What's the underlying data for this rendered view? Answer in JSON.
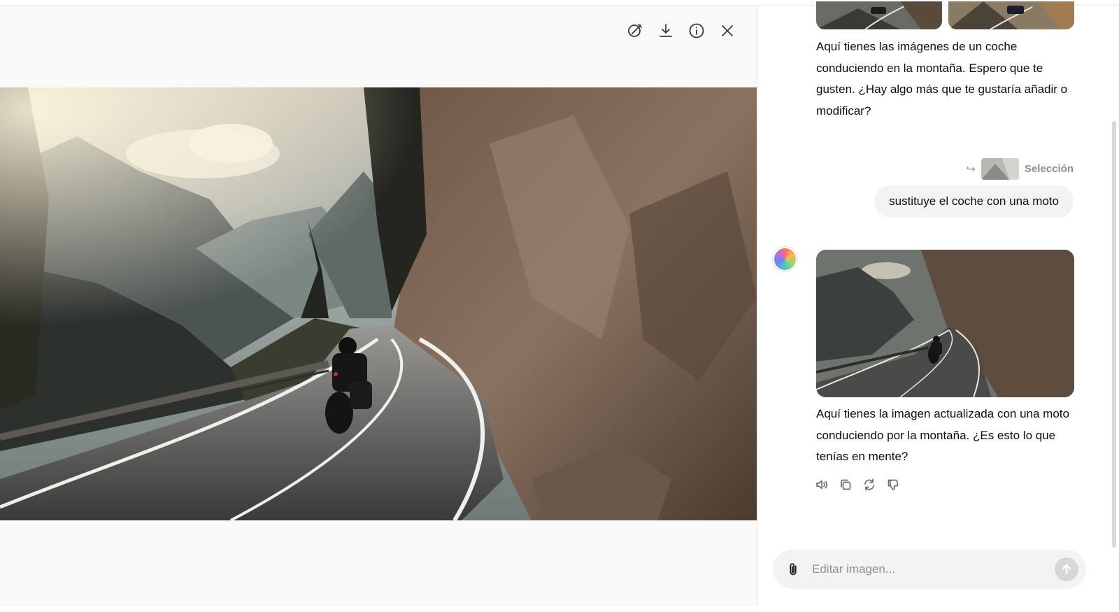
{
  "viewer": {
    "toolbar": [
      {
        "name": "edit-brush-icon"
      },
      {
        "name": "download-icon"
      },
      {
        "name": "info-icon"
      },
      {
        "name": "close-icon"
      }
    ]
  },
  "chat": {
    "assistant_message_1": "Aquí tienes las imágenes de un coche conduciendo en la montaña. Espero que te gusten. ¿Hay algo más que te gustaría añadir o modificar?",
    "selection_label": "Selección",
    "user_message": "sustituye el coche con una moto",
    "assistant_message_2": "Aquí tienes la imagen actualizada con una moto conduciendo por la montaña. ¿Es esto lo que tenías en mente?",
    "actions": [
      "speaker-icon",
      "copy-icon",
      "regenerate-icon",
      "thumbs-down-icon"
    ]
  },
  "composer": {
    "placeholder": "Editar imagen..."
  },
  "colors": {
    "viewer_bg": "#f9f9f9",
    "bubble_bg": "#f3f3f3",
    "send_disabled": "#d7d7d7"
  }
}
